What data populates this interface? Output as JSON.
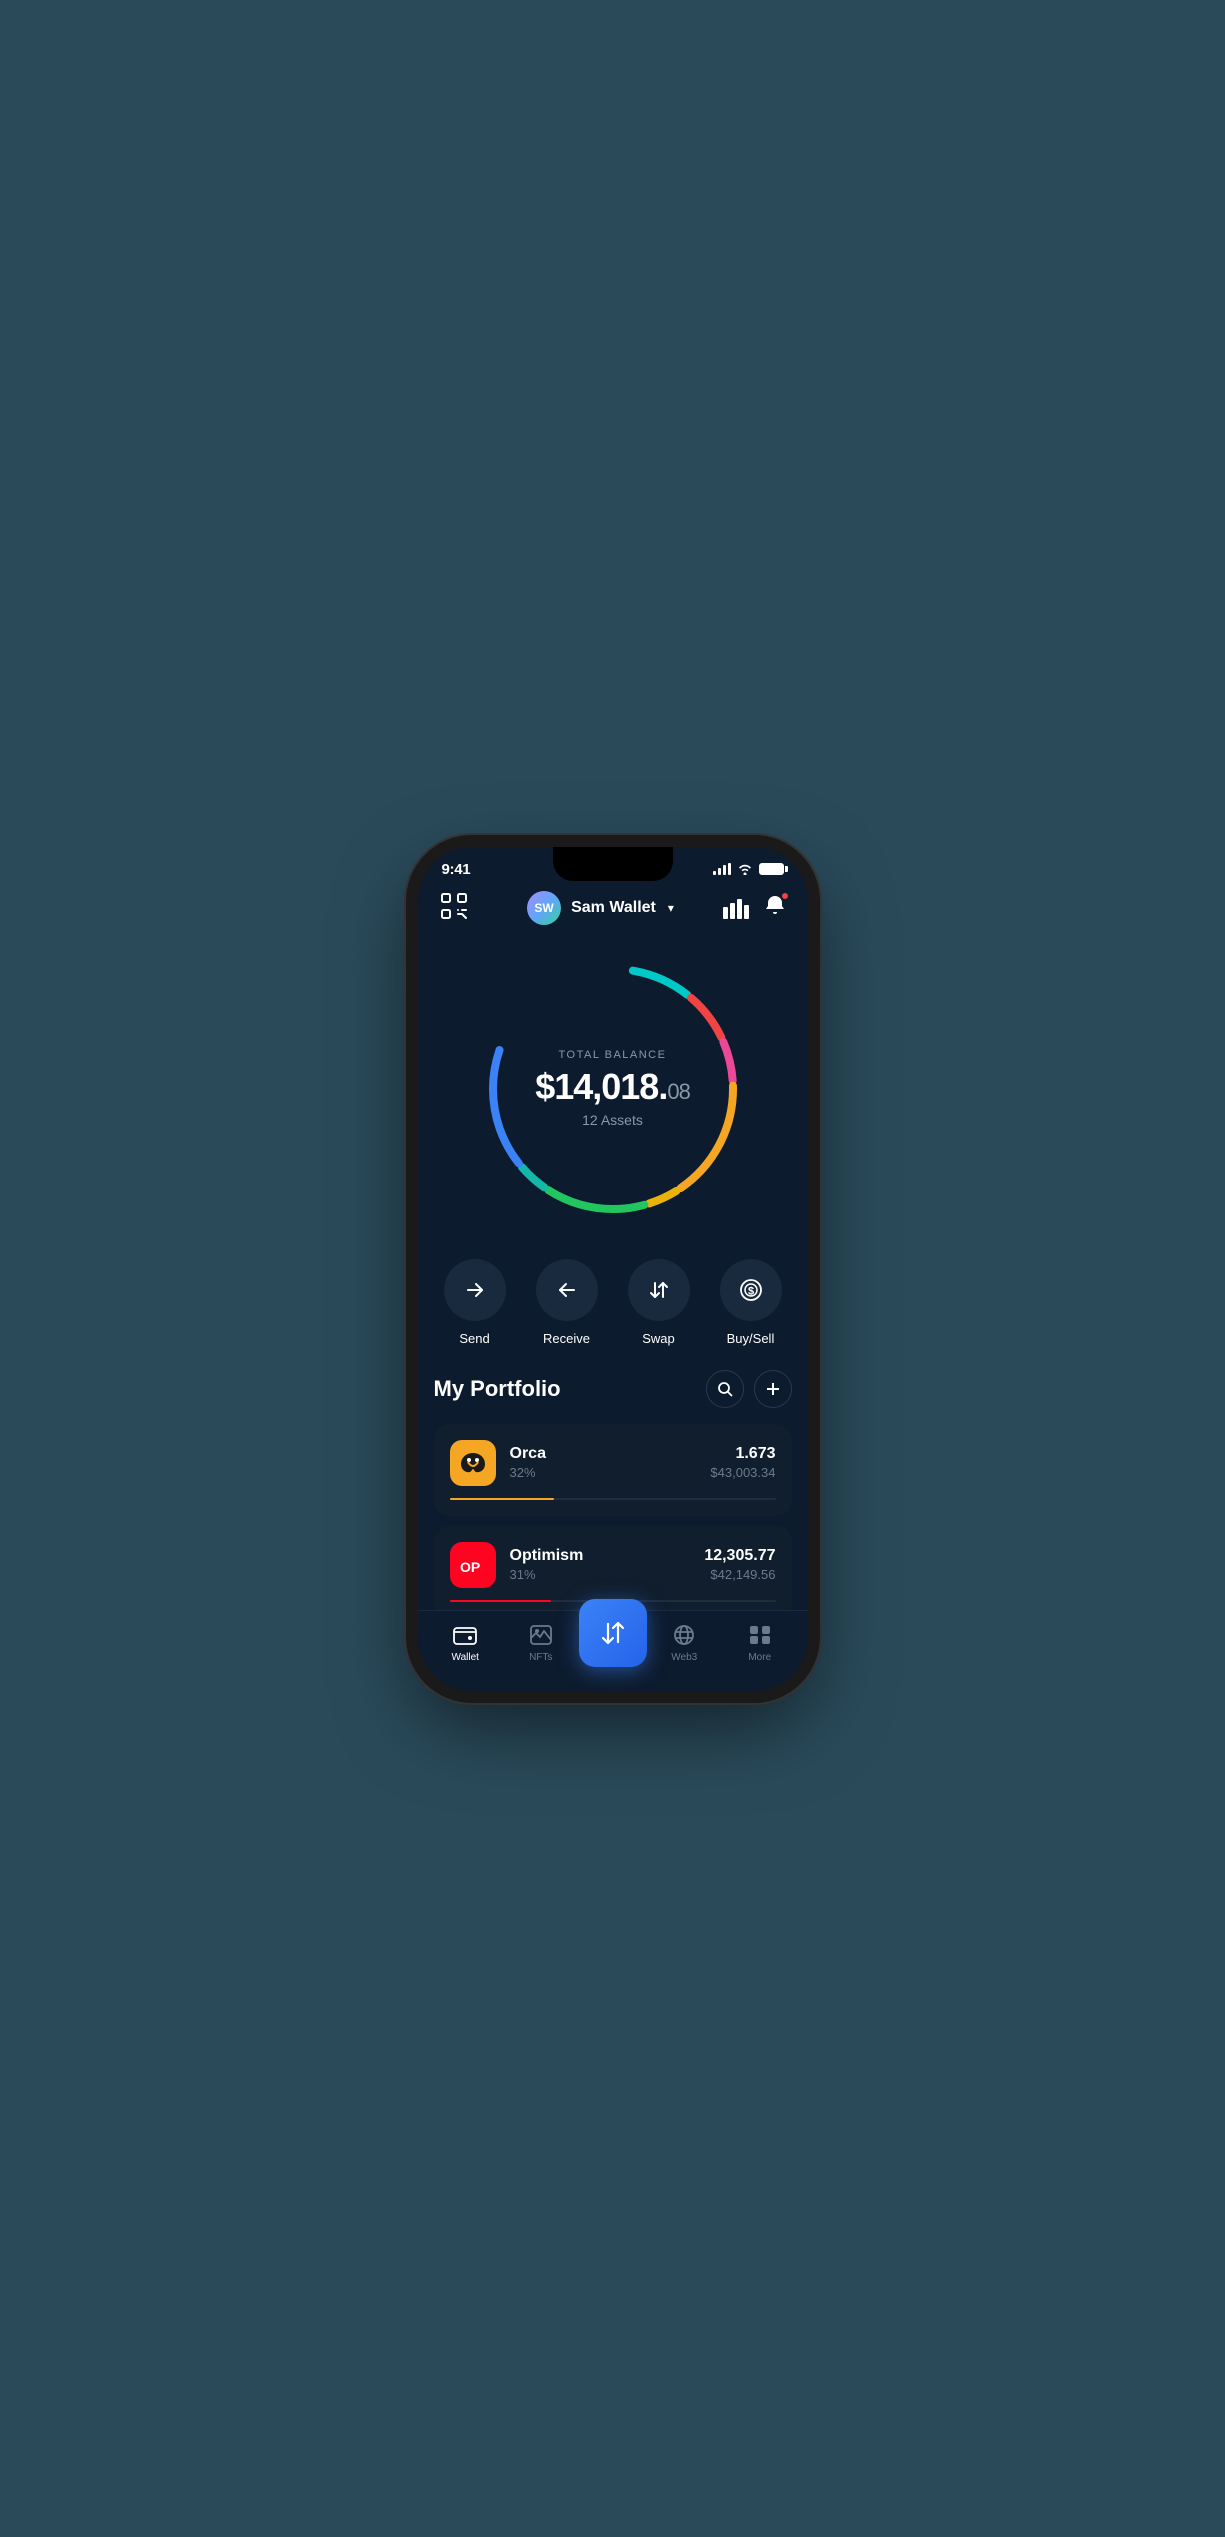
{
  "statusBar": {
    "time": "9:41"
  },
  "header": {
    "scanLabel": "scan",
    "userName": "Sam Wallet",
    "avatarText": "SW",
    "chartLabel": "chart",
    "bellLabel": "notifications"
  },
  "balance": {
    "label": "TOTAL BALANCE",
    "whole": "$14,018.",
    "cents": "08",
    "assetsCount": "12 Assets"
  },
  "actions": [
    {
      "id": "send",
      "label": "Send",
      "icon": "→"
    },
    {
      "id": "receive",
      "label": "Receive",
      "icon": "←"
    },
    {
      "id": "swap",
      "label": "Swap",
      "icon": "⇅"
    },
    {
      "id": "buysell",
      "label": "Buy/Sell",
      "icon": "$"
    }
  ],
  "portfolio": {
    "title": "My Portfolio",
    "searchLabel": "search",
    "addLabel": "add"
  },
  "assets": [
    {
      "id": "orca",
      "name": "Orca",
      "pct": "32%",
      "amount": "1.673",
      "usd": "$43,003.34",
      "iconText": "🐳",
      "progressWidth": "32",
      "progressColor": "#f5a623"
    },
    {
      "id": "optimism",
      "name": "Optimism",
      "pct": "31%",
      "amount": "12,305.77",
      "usd": "$42,149.56",
      "iconText": "OP",
      "progressWidth": "31",
      "progressColor": "#ff0420"
    }
  ],
  "bottomNav": [
    {
      "id": "wallet",
      "label": "Wallet",
      "active": true
    },
    {
      "id": "nfts",
      "label": "NFTs",
      "active": false
    },
    {
      "id": "center",
      "label": "",
      "isCenter": true
    },
    {
      "id": "web3",
      "label": "Web3",
      "active": false
    },
    {
      "id": "more",
      "label": "More",
      "active": false
    }
  ],
  "colors": {
    "bg": "#0d1b2e",
    "card": "#111e2e",
    "accent": "#3b82f6",
    "text": "#ffffff",
    "muted": "#6b7a8d"
  }
}
